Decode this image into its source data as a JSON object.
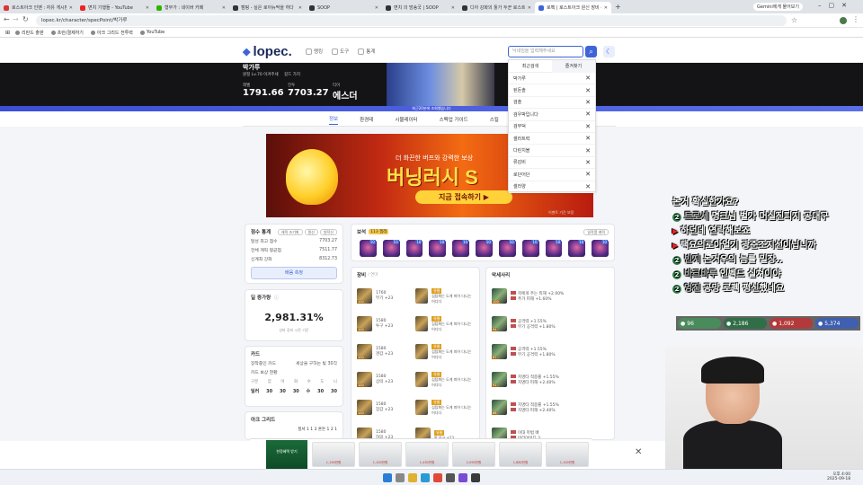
{
  "browser": {
    "tabs": [
      {
        "title": "로스트아크 인벤 : 자유 게시판",
        "color": "#d33"
      },
      {
        "title": "면치 기행들 - YouTube",
        "color": "#e22"
      },
      {
        "title": "형부가 : 네이버 카페",
        "color": "#2db400"
      },
      {
        "title": "캠핑 - 실은 로아뉴딱을 하다",
        "color": "#333"
      },
      {
        "title": "SOOP",
        "color": "#333"
      },
      {
        "title": "면치 의 방송국 | SOOP",
        "color": "#333"
      },
      {
        "title": "디아 강화의 툴가 두꾼 로스트",
        "color": "#333"
      },
      {
        "title": "로펙 | 로스트아크 원신 장비 - ",
        "color": "#3e64d8"
      }
    ],
    "new_tab": "+",
    "gemini": "Gemini에게 물어보기",
    "url": "lopec.kr/character/specPoint/박가루",
    "bookmarks": [
      "리란드 출판",
      "프런/결제하기",
      "아크 그리드 전투력",
      "YouTube"
    ]
  },
  "site": {
    "logo": "lopec.",
    "nav": [
      "랭킹",
      "도구",
      "통계"
    ],
    "search_placeholder": "닉네임을 입력해주세요",
    "search_icon": "search-icon",
    "theme_icon": "moon-icon"
  },
  "hero": {
    "name": "박가루",
    "sub": "원정 Lv.70  이겨주세",
    "sub2": "길드 가치",
    "stats": [
      {
        "label": "레벨",
        "value": "1791.66"
      },
      {
        "label": "전투",
        "value": "7703.27"
      },
      {
        "label": "티어",
        "value": "에스더"
      }
    ],
    "notice": "최근20분에 조회했습니다"
  },
  "dropdown": {
    "tabs": [
      "최근검색",
      "즐겨찾기"
    ],
    "items": [
      "박가루",
      "된돈솔",
      "검솔",
      "검우박입니다",
      "검무덕",
      "셀라트력",
      "다린치블",
      "류감비",
      "로단어단",
      "셀라양"
    ]
  },
  "subnav": [
    "정보",
    "환경테",
    "시뮬레이터",
    "스펙업 가이드",
    "스킬",
    "랭킹"
  ],
  "banner": {
    "line1": "더 화끈한 버프와 강력한 보상",
    "line2": "버닝러시 S",
    "cta": "지금 접속하기 ▶",
    "note": "이벤트 기간 보장"
  },
  "score_card": {
    "title": "점수 통계",
    "pills": [
      "캐릭 조기화",
      "원신",
      "원작신"
    ],
    "rows": [
      {
        "k": "달성 최고 점수",
        "v": "7703.27"
      },
      {
        "k": "전체 캐릭 평균점",
        "v": "7511.77"
      },
      {
        "k": "신계최 강화",
        "v": "8312.73"
      }
    ],
    "button": "배움 측정"
  },
  "gain_card": {
    "title": "딜 증가량",
    "value": "2,981.31%",
    "note": "성파 장비 시즌 기준"
  },
  "card_card": {
    "title": "카드",
    "rows": [
      {
        "k": "장착중인 카드",
        "v": "세상을 구하는 빛 30각"
      },
      {
        "k": "카드 보상 현황",
        "v": ""
      }
    ],
    "headers": [
      "구분",
      "암",
      "어",
      "화",
      "수",
      "도",
      "니"
    ],
    "values": [
      "딜러",
      "30",
      "30",
      "30",
      "수",
      "30",
      "30"
    ]
  },
  "arc_card": {
    "title": "아크 그리드",
    "line": "질서 1 1 3 혼돈 1 2 1"
  },
  "gems": {
    "title": "보석",
    "badge": "113 젬레",
    "btn": "일작품 캐릭",
    "levels": [
      "10",
      "10",
      "10",
      "10",
      "10",
      "10",
      "10",
      "10",
      "10",
      "10",
      "10"
    ]
  },
  "equip": {
    "title": "장비",
    "sub": "/ 연마",
    "left": [
      {
        "lv": "1760",
        "txt": "무기 +23",
        "q": "100"
      },
      {
        "lv": "1580",
        "txt": "투구 +23",
        "q": "100"
      },
      {
        "lv": "1580",
        "txt": "견갑 +23",
        "q": "100"
      },
      {
        "lv": "1580",
        "txt": "상의 +23",
        "q": "100"
      },
      {
        "lv": "1580",
        "txt": "장갑 +23",
        "q": "100"
      },
      {
        "lv": "1580",
        "txt": "하의 +23",
        "q": "100"
      }
    ],
    "right": [
      {
        "txt": "심탐화는 도게 피어 다니는 어디다",
        "tag": "유물"
      },
      {
        "txt": "심탐화는 도게 피어 다니는 어디다",
        "tag": "유물"
      },
      {
        "txt": "심탐화는 도게 피어 다니는 어디다",
        "tag": "유물"
      },
      {
        "txt": "심탐화는 도게 피어 다니는 어디다",
        "tag": "유물"
      },
      {
        "txt": "심탐화는 도게 피어 다니는 어디다",
        "tag": "유물"
      },
      {
        "txt": "팔 아크 +23",
        "tag": "유물"
      }
    ]
  },
  "accessory": {
    "title": "악세사리",
    "rows": [
      {
        "a": "목에게 주는 피해 +2.00%",
        "b": "추가 피해 +1.60%",
        "q": "100"
      },
      {
        "a": "공격력 +1.55%",
        "b": "무기 공격력 +1.80%",
        "q": "94"
      },
      {
        "a": "공격력 +1.55%",
        "b": "무기 공격력 +1.80%",
        "q": "87"
      },
      {
        "a": "치명타 적중률 +1.55%",
        "b": "치명타 피해 +2.40%",
        "q": "91"
      },
      {
        "a": "치명타 적중률 +1.55%",
        "b": "치명타 피해 +2.40%",
        "q": "88"
      },
      {
        "a": "이대 마법 배",
        "b": "마리아어디 3",
        "q": "100"
      }
    ]
  },
  "stream": {
    "chat": [
      {
        "nm": "",
        "msg": "논거 확실한가요?"
      },
      {
        "nm": "트로세",
        "msg": "명크님 벌가 머실진피지 공대구"
      },
      {
        "nm": "",
        "msg": "하던데 연락해보죠"
      },
      {
        "nm": "",
        "msg": "택요의로아얼기 광준조지선이닙니까"
      },
      {
        "nm": "빈지",
        "msg": "논거우의 늠를 밀장.."
      },
      {
        "nm": "바크바루",
        "msg": "인벡드 실쳐이야"
      },
      {
        "nm": "엉진",
        "msg": "공망 로펙 평신했네요"
      }
    ],
    "poll": [
      "96",
      "2,186",
      "1,092",
      "5,374"
    ],
    "poll_colors": [
      "#4a8b5c",
      "#2f6e46",
      "#b33a3a",
      "#3f5fb0"
    ]
  },
  "ads": {
    "left_text": "한정혜택 받기",
    "cars": [
      "1,190만원",
      "1,100만원",
      "1,430만원",
      "2,090만원",
      "1,880만원",
      "1,100만원"
    ]
  },
  "taskbar": {
    "clock": "오후 4:00",
    "date": "2025-09-18"
  }
}
